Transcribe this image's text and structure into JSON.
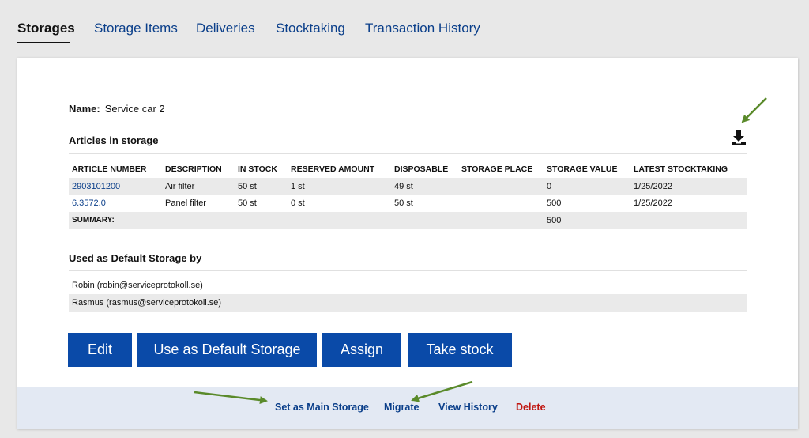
{
  "tabs": [
    {
      "label": "Storages",
      "active": true
    },
    {
      "label": "Storage Items"
    },
    {
      "label": "Deliveries"
    },
    {
      "label": "Stocktaking"
    },
    {
      "label": "Transaction History"
    }
  ],
  "storage": {
    "name_label": "Name:",
    "name_value": "Service car 2"
  },
  "articles": {
    "title": "Articles in storage",
    "download_icon": "download-icon",
    "columns": [
      "ARTICLE NUMBER",
      "DESCRIPTION",
      "IN STOCK",
      "RESERVED AMOUNT",
      "DISPOSABLE",
      "STORAGE PLACE",
      "STORAGE VALUE",
      "LATEST STOCKTAKING"
    ],
    "rows": [
      {
        "article_number": "2903101200",
        "description": "Air filter",
        "in_stock": "50 st",
        "reserved": "1 st",
        "disposable": "49 st",
        "place": "",
        "value": "0",
        "latest": "1/25/2022"
      },
      {
        "article_number": "6.3572.0",
        "description": "Panel filter",
        "in_stock": "50 st",
        "reserved": "0 st",
        "disposable": "50 st",
        "place": "",
        "value": "500",
        "latest": "1/25/2022"
      }
    ],
    "summary_label": "SUMMARY:",
    "summary_value": "500"
  },
  "default_storage": {
    "title": "Used as Default Storage by",
    "users": [
      "Robin (robin@serviceprotokoll.se)",
      "Rasmus (rasmus@serviceprotokoll.se)"
    ]
  },
  "buttons": {
    "edit": "Edit",
    "use_default": "Use as Default Storage",
    "assign": "Assign",
    "take_stock": "Take stock"
  },
  "footer_links": {
    "set_main": "Set as Main Storage",
    "migrate": "Migrate",
    "view_history": "View History",
    "delete": "Delete"
  },
  "colors": {
    "primary": "#0a4aa8",
    "link": "#0b3f8a",
    "danger": "#c0150f",
    "annotation_arrow": "#5a8a2a"
  }
}
